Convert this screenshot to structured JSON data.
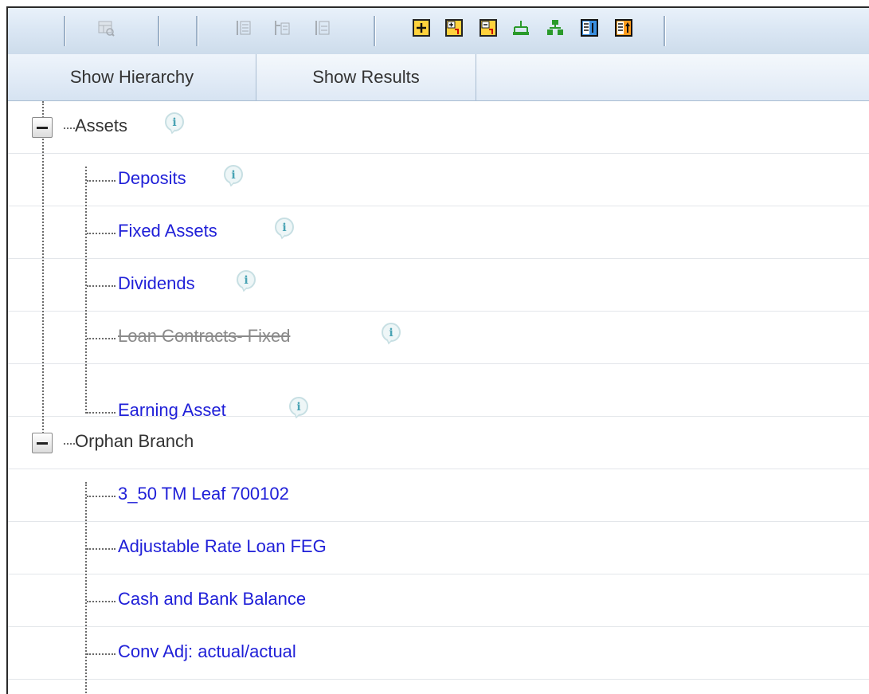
{
  "toolbar": {
    "icons": [
      "table-view-icon",
      "move-up-icon",
      "move-level-icon",
      "move-down-icon",
      "add-node-icon",
      "expand-branch-icon",
      "collapse-branch-icon",
      "hierarchy-icon",
      "hierarchy-green-icon",
      "list-view-icon",
      "node-properties-icon"
    ]
  },
  "tabs": [
    {
      "label": "Show Hierarchy",
      "active": true
    },
    {
      "label": "Show Results",
      "active": false
    }
  ],
  "tree": {
    "assets": {
      "label": "Assets"
    },
    "deposits": {
      "label": "Deposits"
    },
    "fixed_assets": {
      "label": "Fixed Assets"
    },
    "dividends": {
      "label": "Dividends"
    },
    "loan_contracts": {
      "label": "Loan Contracts- Fixed"
    },
    "earning_asset": {
      "label": "Earning Asset"
    },
    "orphan_branch": {
      "label": "Orphan Branch"
    },
    "leaf_700102": {
      "label": "3_50 TM Leaf 700102"
    },
    "adjustable_rate": {
      "label": "Adjustable Rate Loan FEG"
    },
    "cash_bank": {
      "label": "Cash and Bank Balance"
    },
    "conv_adj": {
      "label": "Conv Adj: actual/actual"
    }
  },
  "colors": {
    "leaf_link": "#2020d8",
    "disabled": "#8a8a8a",
    "toolbar_bg": "#dbe7f4"
  }
}
